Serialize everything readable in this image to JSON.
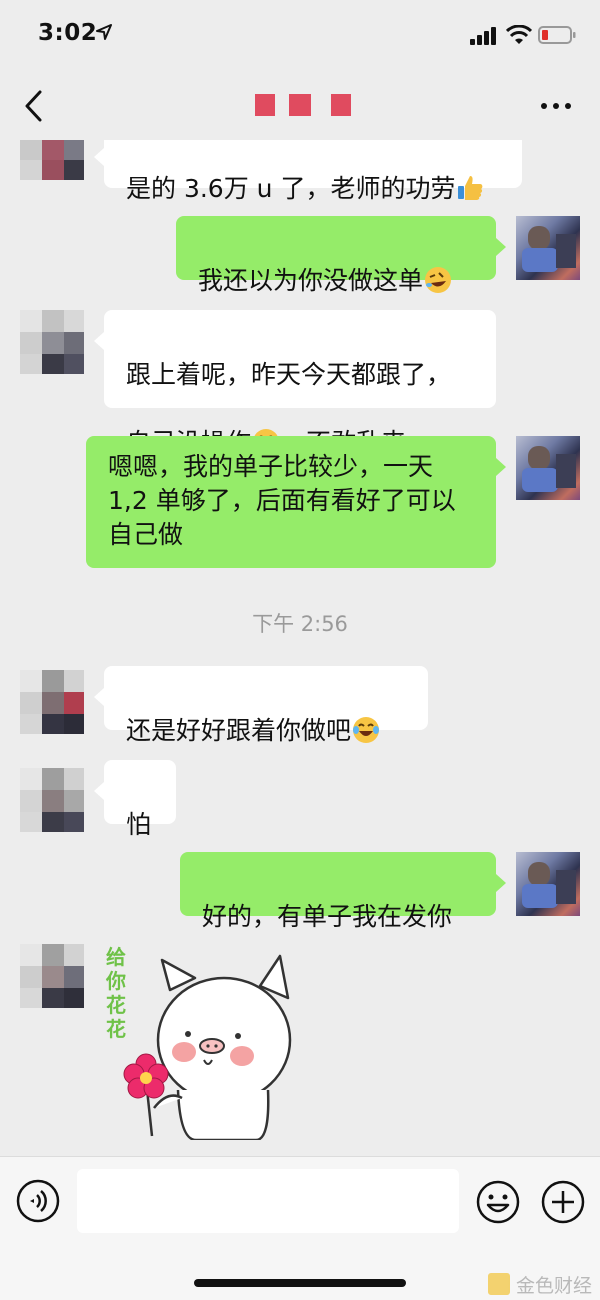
{
  "status_bar": {
    "time": "3:02"
  },
  "chat_title": "",
  "messages": [
    {
      "sender": "contact",
      "text": "是的 3.6万 u 了，老师的功劳",
      "emoji": "thumbs-up"
    },
    {
      "sender": "me",
      "text": "我还以为你没做这单",
      "emoji": "rofl"
    },
    {
      "sender": "contact",
      "text_line1": "跟上着呢，昨天今天都跟了，",
      "text_line2_a": "自己没操作",
      "emoji": "joy",
      "text_line2_b": "，不敢乱来"
    },
    {
      "sender": "me",
      "text": "嗯嗯，我的单子比较少，一天\n1,2 单够了，后面有看好了可以\n自己做"
    },
    {
      "sender": "contact",
      "text": "还是好好跟着你做吧",
      "emoji": "joy"
    },
    {
      "sender": "contact",
      "text": "怕"
    },
    {
      "sender": "me",
      "text": "好的，有单子我在发你"
    },
    {
      "sender": "contact",
      "type": "sticker",
      "sticker_text": "给你花花"
    }
  ],
  "timestamp": "下午 2:56",
  "input": {
    "placeholder": ""
  },
  "watermark": {
    "text": "金色财经"
  },
  "colors": {
    "bg": "#ededed",
    "bubble_me": "#95ec69",
    "bubble_contact": "#ffffff"
  }
}
